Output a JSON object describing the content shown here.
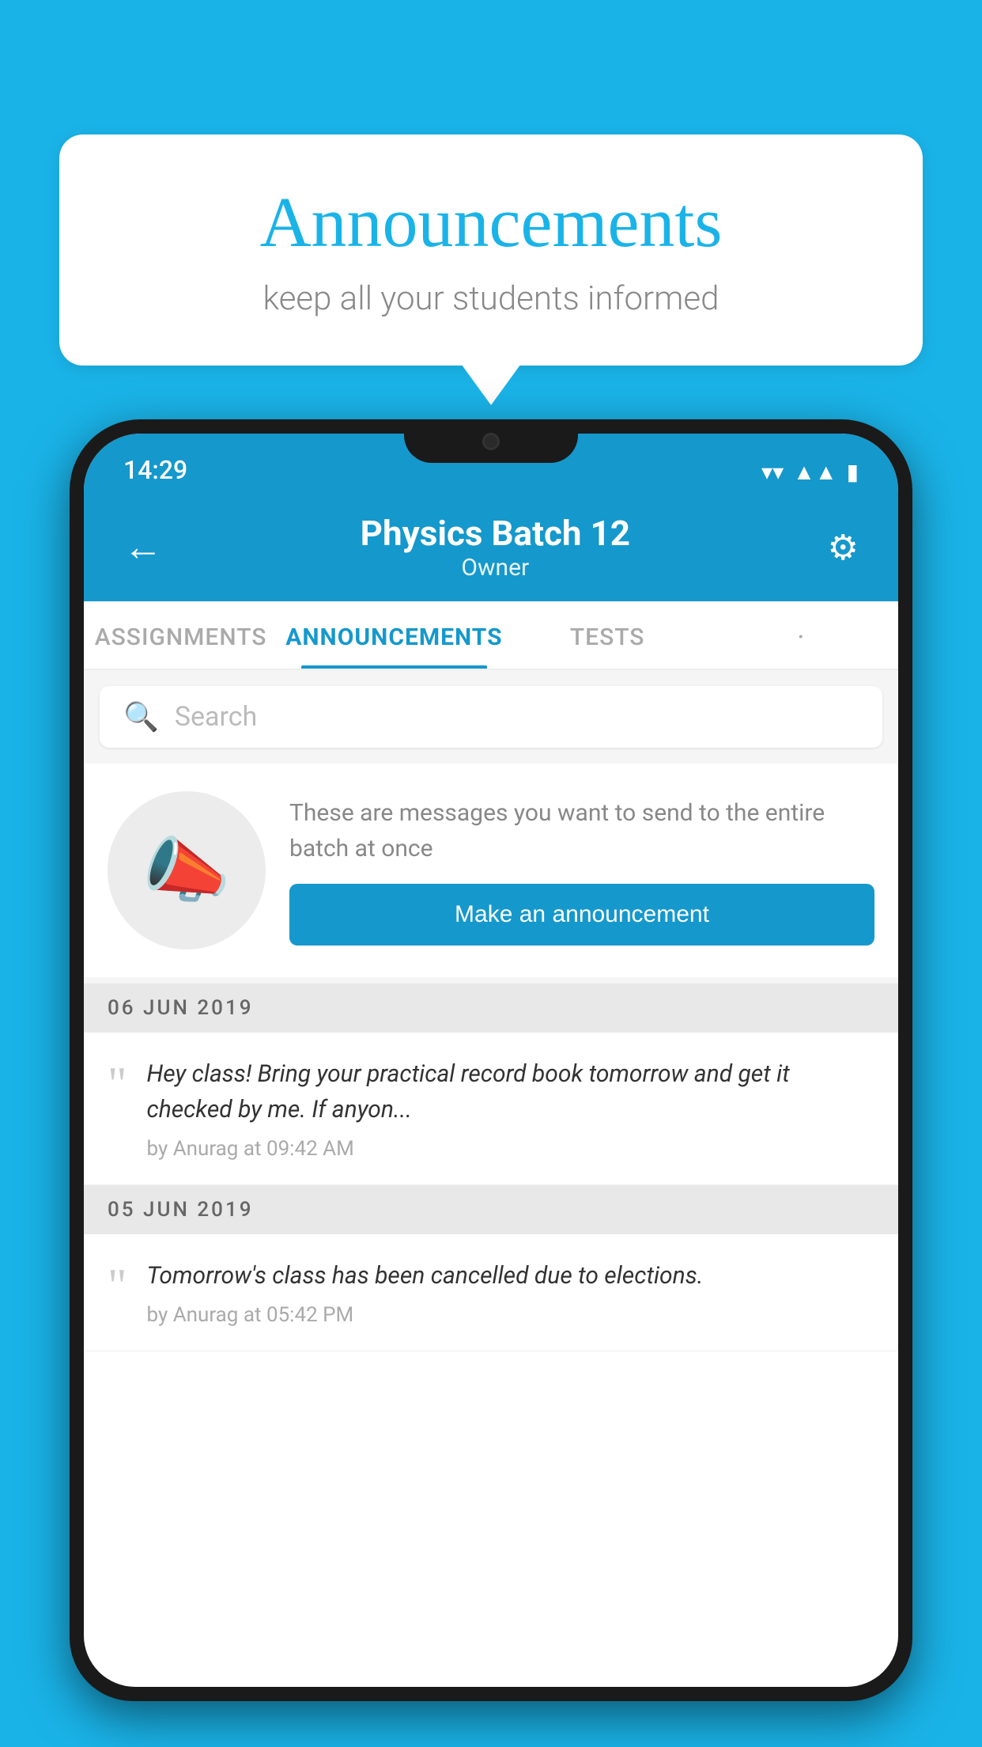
{
  "page": {
    "background_color": "#1ab3e8"
  },
  "speech_bubble": {
    "title": "Announcements",
    "subtitle": "keep all your students informed"
  },
  "phone": {
    "status_bar": {
      "time": "14:29"
    },
    "header": {
      "title": "Physics Batch 12",
      "subtitle": "Owner",
      "back_label": "←",
      "gear_label": "⚙"
    },
    "tabs": [
      {
        "label": "ASSIGNMENTS",
        "active": false
      },
      {
        "label": "ANNOUNCEMENTS",
        "active": true
      },
      {
        "label": "TESTS",
        "active": false
      },
      {
        "label": "·",
        "active": false
      }
    ],
    "search": {
      "placeholder": "Search"
    },
    "announcement_prompt": {
      "description": "These are messages you want to send to the entire batch at once",
      "button_label": "Make an announcement"
    },
    "announcements": [
      {
        "date": "06  JUN  2019",
        "message": "Hey class! Bring your practical record book tomorrow and get it checked by me. If anyon...",
        "meta": "by Anurag at 09:42 AM"
      },
      {
        "date": "05  JUN  2019",
        "message": "Tomorrow's class has been cancelled due to elections.",
        "meta": "by Anurag at 05:42 PM"
      }
    ]
  }
}
